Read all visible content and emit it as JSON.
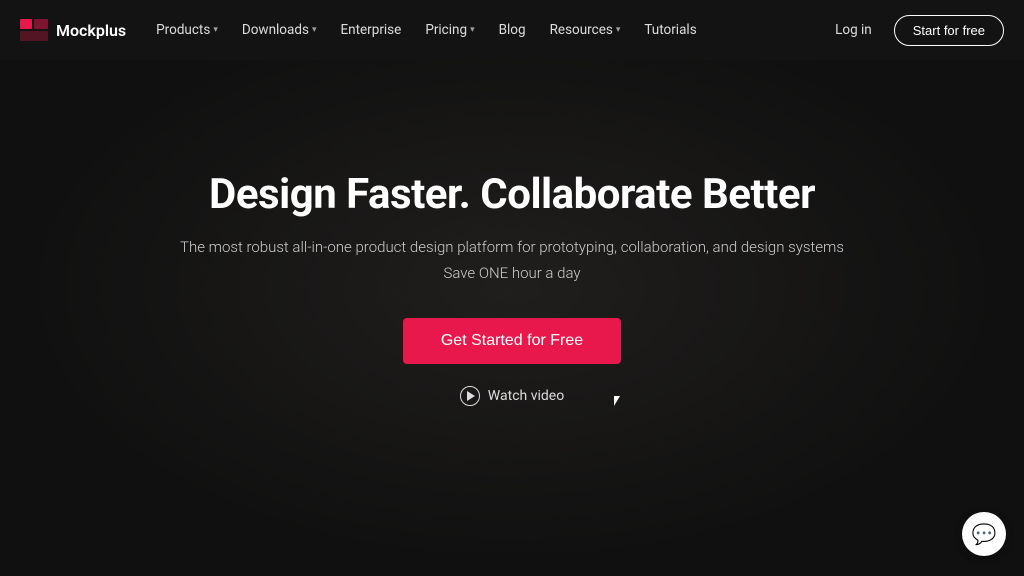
{
  "brand": {
    "name": "Mockplus",
    "logo_alt": "Mockplus logo"
  },
  "nav": {
    "items": [
      {
        "id": "products",
        "label": "Products",
        "has_dropdown": true
      },
      {
        "id": "downloads",
        "label": "Downloads",
        "has_dropdown": true
      },
      {
        "id": "enterprise",
        "label": "Enterprise",
        "has_dropdown": false
      },
      {
        "id": "pricing",
        "label": "Pricing",
        "has_dropdown": true
      },
      {
        "id": "blog",
        "label": "Blog",
        "has_dropdown": false
      },
      {
        "id": "resources",
        "label": "Resources",
        "has_dropdown": true
      },
      {
        "id": "tutorials",
        "label": "Tutorials",
        "has_dropdown": false
      }
    ],
    "login_label": "Log in",
    "start_label": "Start for free"
  },
  "hero": {
    "title": "Design Faster. Collaborate Better",
    "subtitle": "The most robust all-in-one product design platform for prototyping, collaboration, and design systems",
    "tagline": "Save ONE hour a day",
    "cta_label": "Get Started for Free",
    "watch_label": "Watch video"
  },
  "chat": {
    "icon": "💬"
  }
}
